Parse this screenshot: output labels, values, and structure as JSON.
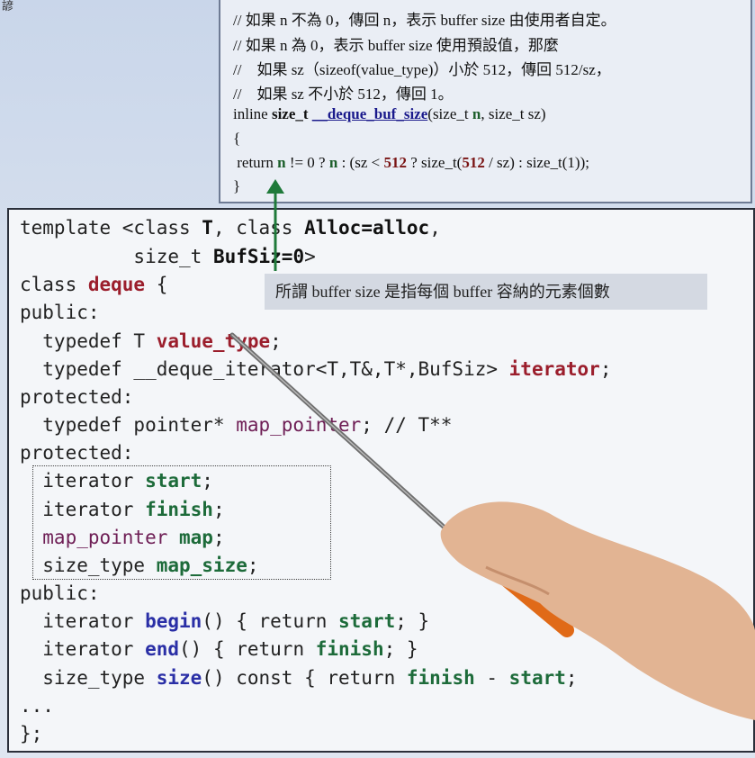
{
  "corner_text": "諺",
  "note": {
    "line1": "// 如果 n 不為 0，傳回 n，表示 buffer size 由使用者自定。",
    "line2": "// 如果 n 為 0，表示 buffer size 使用預設值，那麼",
    "line3": "//    如果 sz（sizeof(value_type)）小於 512，傳回 512/sz，",
    "line4": "//    如果 sz 不小於 512，傳回 1。",
    "sig_prefix": "inline ",
    "sig_type": "size_t",
    "sig_space": " ",
    "sig_fn": "__deque_buf_size",
    "sig_args_a": "(size_t ",
    "sig_n": "n",
    "sig_args_b": ", size_t sz)",
    "brace_open": "{",
    "ret_a": " return ",
    "ret_n1": "n",
    "ret_b": " != 0 ? ",
    "ret_n2": "n",
    "ret_c": " : (sz < ",
    "ret_512a": "512",
    "ret_d": " ? size_t(",
    "ret_512b": "512",
    "ret_e": " / sz) : size_t(1));",
    "brace_close": "}"
  },
  "callout": "所謂 buffer size 是指每個 buffer 容納的元素個數",
  "code": {
    "l1_a": "template <class ",
    "l1_T": "T",
    "l1_b": ", class ",
    "l1_alloc": "Alloc=alloc",
    "l1_c": ",",
    "l2_a": "          size_t ",
    "l2_buf": "BufSiz=0",
    "l2_b": ">",
    "l3_a": "class ",
    "l3_deque": "deque",
    "l3_b": " {",
    "l4": "public:",
    "l5_a": "  typedef T ",
    "l5_vt": "value_type",
    "l5_b": ";",
    "l6_a": "  typedef __deque_iterator<T,T&,T*,BufSiz> ",
    "l6_it": "iterator",
    "l6_b": ";",
    "l7": "protected:",
    "l8_a": "  typedef pointer* ",
    "l8_mp": "map_pointer",
    "l8_b": "; // T**",
    "l9": "protected:",
    "l10_a": "  iterator ",
    "l10_s": "start",
    "l10_b": ";",
    "l11_a": "  iterator ",
    "l11_f": "finish",
    "l11_b": ";",
    "l12_a": "  map_pointer ",
    "l12_m": "map",
    "l12_b": ";",
    "l13_a": "  size_type ",
    "l13_ms": "map_size",
    "l13_b": ";",
    "l14": "public:",
    "l15_a": "  iterator ",
    "l15_fn": "begin",
    "l15_b": "() { return ",
    "l15_s": "start",
    "l15_c": "; }",
    "l16_a": "  iterator ",
    "l16_fn": "end",
    "l16_b": "() { return ",
    "l16_f": "finish",
    "l16_c": "; }",
    "l17_a": "  size_type ",
    "l17_fn": "size",
    "l17_b": "() const { return ",
    "l17_f": "finish",
    "l17_c": " - ",
    "l17_s": "start",
    "l17_d": ";",
    "l18": "...",
    "l19": "};"
  },
  "colors": {
    "keyword_red": "#9b1e2c",
    "member_green": "#1d6b3a",
    "function_blue": "#2a2fa6",
    "arrow_green": "#1f7a3a",
    "pointer_orange": "#e06a18"
  }
}
